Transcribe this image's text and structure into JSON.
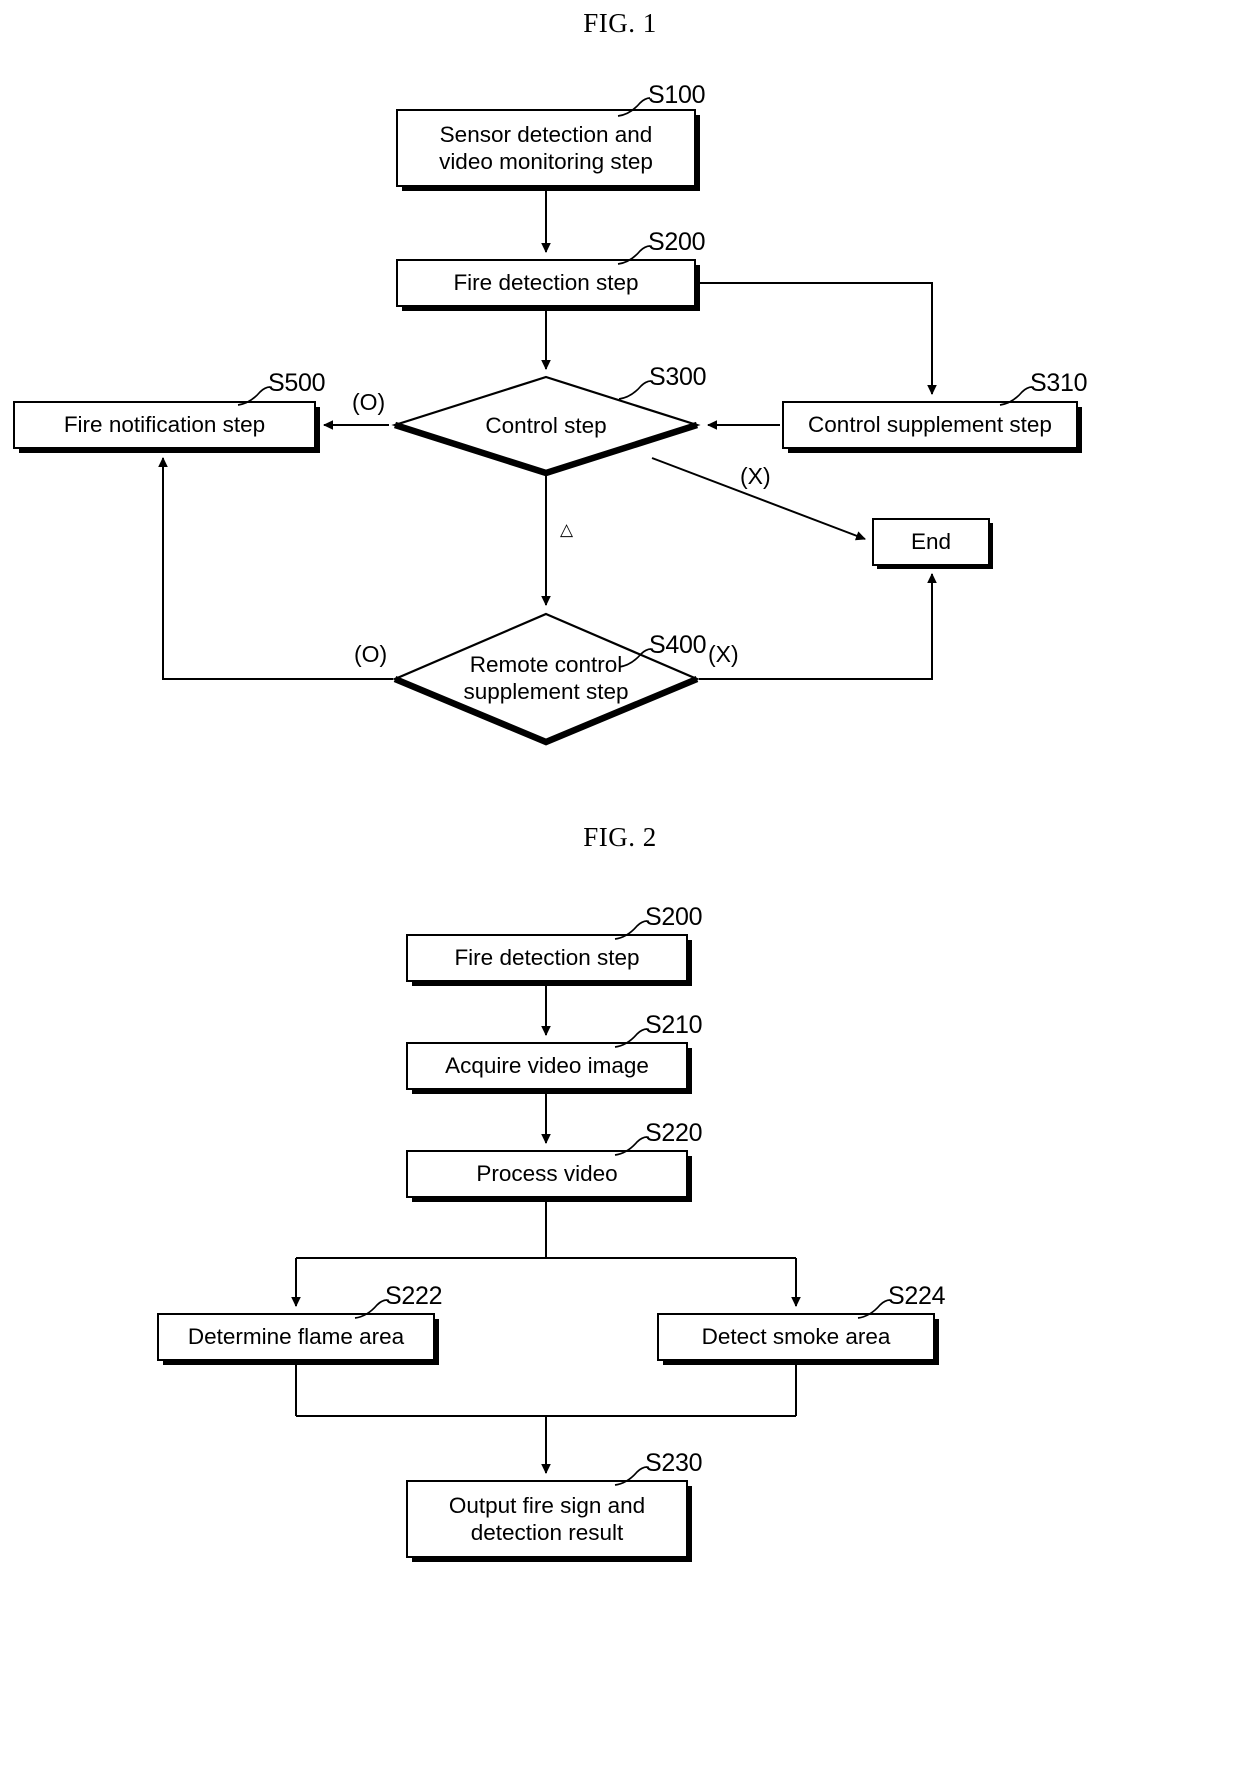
{
  "figures": [
    {
      "caption": "FIG. 1",
      "nodes": [
        {
          "id": "S100",
          "label": "Sensor detection and\nvideo monitoring step",
          "ref": "S100",
          "shape": "process"
        },
        {
          "id": "S200",
          "label": "Fire detection step",
          "ref": "S200",
          "shape": "process"
        },
        {
          "id": "S300",
          "label": "Control step",
          "ref": "S300",
          "shape": "decision"
        },
        {
          "id": "S310",
          "label": "Control supplement step",
          "ref": "S310",
          "shape": "process"
        },
        {
          "id": "S500",
          "label": "Fire notification step",
          "ref": "S500",
          "shape": "process"
        },
        {
          "id": "S400",
          "label": "Remote control\nsupplement step",
          "ref": "S400",
          "shape": "decision"
        },
        {
          "id": "END",
          "label": "End",
          "ref": "",
          "shape": "terminator"
        }
      ],
      "branch_labels": [
        {
          "text": "(O)",
          "for": "S300-to-S500"
        },
        {
          "text": "(X)",
          "for": "S300-to-End"
        },
        {
          "text": "△",
          "for": "S300-to-S400"
        },
        {
          "text": "(O)",
          "for": "S400-to-S500"
        },
        {
          "text": "(X)",
          "for": "S400-to-End"
        }
      ]
    },
    {
      "caption": "FIG. 2",
      "nodes": [
        {
          "id": "S200b",
          "label": "Fire detection step",
          "ref": "S200",
          "shape": "process"
        },
        {
          "id": "S210",
          "label": "Acquire video image",
          "ref": "S210",
          "shape": "process"
        },
        {
          "id": "S220",
          "label": "Process video",
          "ref": "S220",
          "shape": "process"
        },
        {
          "id": "S222",
          "label": "Determine flame area",
          "ref": "S222",
          "shape": "process"
        },
        {
          "id": "S224",
          "label": "Detect smoke area",
          "ref": "S224",
          "shape": "process"
        },
        {
          "id": "S230",
          "label": "Output fire sign and\ndetection result",
          "ref": "S230",
          "shape": "process"
        }
      ]
    }
  ],
  "fig1": {
    "caption": "FIG. 1",
    "s100": {
      "line1": "Sensor detection and",
      "line2": "video monitoring step",
      "ref": "S100"
    },
    "s200": {
      "label": "Fire detection step",
      "ref": "S200"
    },
    "s300": {
      "label": "Control step",
      "ref": "S300"
    },
    "s310": {
      "label": "Control supplement step",
      "ref": "S310"
    },
    "s500": {
      "label": "Fire notification step",
      "ref": "S500"
    },
    "s400": {
      "line1": "Remote control",
      "line2": "supplement step",
      "ref": "S400"
    },
    "end": {
      "label": "End"
    },
    "labels": {
      "o_left": "(O)",
      "x_right": "(X)",
      "triangle": "△",
      "o_bottom_left": "(O)",
      "x_bottom_right": "(X)"
    }
  },
  "fig2": {
    "caption": "FIG. 2",
    "s200": {
      "label": "Fire detection step",
      "ref": "S200"
    },
    "s210": {
      "label": "Acquire video image",
      "ref": "S210"
    },
    "s220": {
      "label": "Process video",
      "ref": "S220"
    },
    "s222": {
      "label": "Determine flame area",
      "ref": "S222"
    },
    "s224": {
      "label": "Detect smoke area",
      "ref": "S224"
    },
    "s230": {
      "line1": "Output fire sign and",
      "line2": "detection result",
      "ref": "S230"
    }
  },
  "colors": {
    "ink": "#000000",
    "paper": "#ffffff"
  }
}
